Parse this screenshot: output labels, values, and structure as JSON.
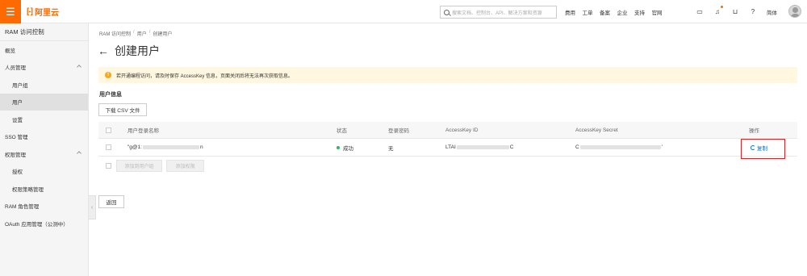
{
  "topbar": {
    "menu_icon": "menu-icon",
    "logo_text": "阿里云",
    "logo_mark": "[-]",
    "search_placeholder": "搜索文档、控制台、API、解决方案和资源",
    "nav": [
      "费用",
      "工单",
      "备案",
      "企业",
      "支持",
      "官网"
    ],
    "icons": [
      "terminal-icon",
      "bell-icon",
      "cart-icon",
      "help-icon"
    ],
    "language": "简体",
    "accent_color": "#ff6a00"
  },
  "sidebar": {
    "title": "RAM 访问控制",
    "items": [
      {
        "label": "概览"
      },
      {
        "label": "人员管理"
      },
      {
        "label": "用户组"
      },
      {
        "label": "用户"
      },
      {
        "label": "设置"
      },
      {
        "label": "SSO 管理"
      },
      {
        "label": "权限管理"
      },
      {
        "label": "授权"
      },
      {
        "label": "权限策略管理"
      },
      {
        "label": "RAM 角色管理"
      },
      {
        "label": "OAuth 应用管理（公测中）"
      }
    ],
    "active": "用户"
  },
  "breadcrumb": [
    "RAM 访问控制",
    "用户",
    "创建用户"
  ],
  "breadcrumb_sep": "/",
  "page": {
    "title": "创建用户",
    "back_glyph": "←",
    "alert_icon": "!",
    "alert": "若开通编程访问，请及时保存 AccessKey 信息，页面关闭后将无法再次获取信息。",
    "section_title": "用户信息",
    "download_csv": "下载 CSV 文件",
    "back_button": "返回"
  },
  "table": {
    "headers": [
      "用户登录名称",
      "状态",
      "登录密码",
      "AccessKey ID",
      "AccessKey Secret",
      "操作"
    ],
    "rows": [
      {
        "login_prefix": "\"g@1:",
        "login_suffix": "n",
        "status": "成功",
        "password": "无",
        "ak_prefix": "LTAI",
        "ak_suffix": "C",
        "secret_prefix": "C",
        "secret_suffix": "'",
        "action": "复制"
      }
    ],
    "add_buttons": [
      "添加到用户组",
      "添加权限"
    ],
    "status_color": "#2eb85c",
    "link_color": "#0070cc",
    "highlight_color": "#e02020"
  }
}
